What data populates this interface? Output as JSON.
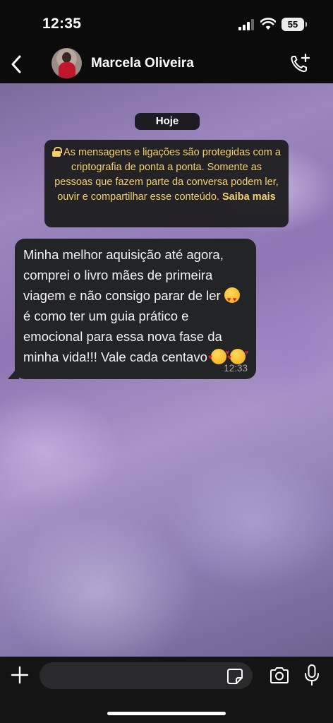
{
  "status_bar": {
    "time": "12:35",
    "battery_level": "55"
  },
  "header": {
    "contact_name": "Marcela Oliveira"
  },
  "chat": {
    "date_label": "Hoje",
    "encryption_notice": {
      "text": "As mensagens e ligações são protegidas com a criptografia de ponta a ponta. Somente as pessoas que fazem parte da conversa podem ler, ouvir e compartilhar esse conteúdo.",
      "link_text": "Saiba mais"
    },
    "messages": [
      {
        "direction": "incoming",
        "text_part1": "Minha melhor aquisição até agora, comprei o livro mães de primeira viagem e não consigo parar de ler ",
        "text_part2": " é como ter um guia prático e emocional para essa nova fase da minha vida!!! Vale cada centavo ",
        "emojis": [
          "smiling-face-with-heart-eyes",
          "smiling-face-with-hearts",
          "smiling-face-with-hearts"
        ],
        "time": "12:33"
      }
    ]
  },
  "input_bar": {
    "placeholder": ""
  },
  "icons": {
    "back": "chevron-left-icon",
    "add_call": "phone-plus-icon",
    "attach": "plus-icon",
    "sticker": "sticker-icon",
    "camera": "camera-icon",
    "mic": "microphone-icon"
  },
  "colors": {
    "notice_text": "#f5d06a",
    "bubble_bg": "#232426",
    "bar_bg": "#0b0b0b"
  }
}
